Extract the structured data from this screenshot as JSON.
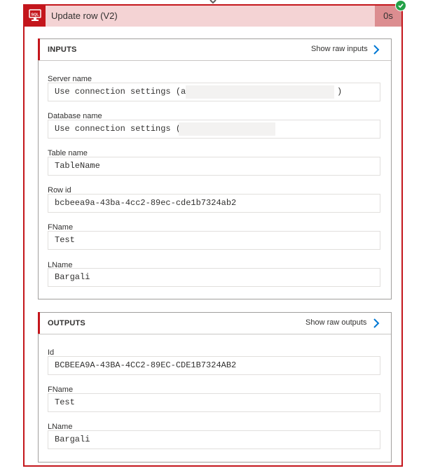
{
  "action": {
    "title": "Update row (V2)",
    "duration": "0s",
    "status": "succeeded"
  },
  "inputs": {
    "section_title": "INPUTS",
    "raw_link": "Show raw inputs",
    "fields": [
      {
        "label": "Server name",
        "value": "Use connection settings (a",
        "suffix": ")",
        "redacted": true
      },
      {
        "label": "Database name",
        "value": "Use connection settings (",
        "redacted": true
      },
      {
        "label": "Table name",
        "value": "TableName"
      },
      {
        "label": "Row id",
        "value": "bcbeea9a-43ba-4cc2-89ec-cde1b7324ab2"
      },
      {
        "label": "FName",
        "value": "Test"
      },
      {
        "label": "LName",
        "value": "Bargali"
      }
    ]
  },
  "outputs": {
    "section_title": "OUTPUTS",
    "raw_link": "Show raw outputs",
    "fields": [
      {
        "label": "Id",
        "value": "BCBEEA9A-43BA-4CC2-89EC-CDE1B7324AB2"
      },
      {
        "label": "FName",
        "value": "Test"
      },
      {
        "label": "LName",
        "value": "Bargali"
      }
    ]
  },
  "colors": {
    "error_red": "#c4161c",
    "header_bg": "#f4d3d4",
    "duration_bg": "#dc8d90",
    "success_green": "#24a148",
    "link_blue": "#0078d4"
  }
}
